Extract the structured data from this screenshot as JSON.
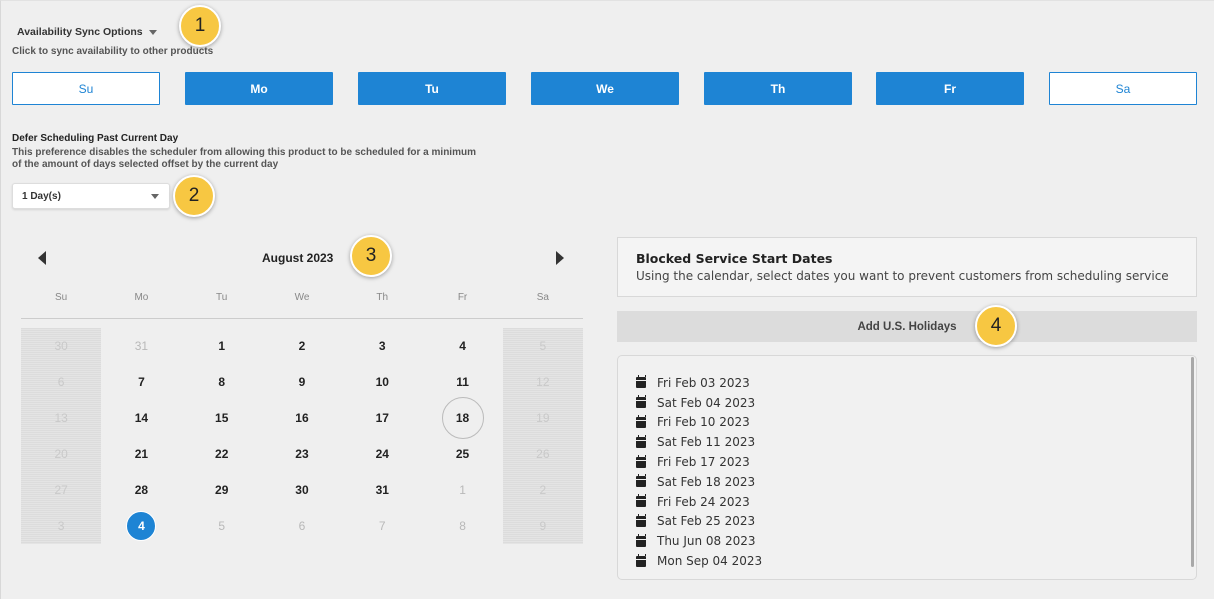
{
  "sync": {
    "title": "Availability Sync Options",
    "subtitle": "Click to sync availability to other products",
    "days": [
      {
        "label": "Su",
        "selected": false
      },
      {
        "label": "Mo",
        "selected": true
      },
      {
        "label": "Tu",
        "selected": true
      },
      {
        "label": "We",
        "selected": true
      },
      {
        "label": "Th",
        "selected": true
      },
      {
        "label": "Fr",
        "selected": true
      },
      {
        "label": "Sa",
        "selected": false
      }
    ]
  },
  "defer": {
    "title": "Defer Scheduling Past Current Day",
    "description": "This preference disables the scheduler from allowing this product to be scheduled for a minimum of the amount of days selected offset by the current day",
    "selected_value": "1 Day(s)"
  },
  "calendar": {
    "title": "August 2023",
    "weekdays": [
      "Su",
      "Mo",
      "Tu",
      "We",
      "Th",
      "Fr",
      "Sa"
    ],
    "weeks": [
      [
        "30",
        "31",
        "1",
        "2",
        "3",
        "4",
        "5"
      ],
      [
        "6",
        "7",
        "8",
        "9",
        "10",
        "11",
        "12"
      ],
      [
        "13",
        "14",
        "15",
        "16",
        "17",
        "18",
        "19"
      ],
      [
        "20",
        "21",
        "22",
        "23",
        "24",
        "25",
        "26"
      ],
      [
        "27",
        "28",
        "29",
        "30",
        "31",
        "1",
        "2"
      ],
      [
        "3",
        "4",
        "5",
        "6",
        "7",
        "8",
        "9"
      ]
    ],
    "today": "18",
    "selected": "4"
  },
  "blocked": {
    "title": "Blocked Service Start Dates",
    "description": "Using the calendar, select dates you want to prevent customers from scheduling service",
    "add_holidays_label": "Add U.S. Holidays",
    "dates": [
      "Fri Feb 03 2023",
      "Sat Feb 04 2023",
      "Fri Feb 10 2023",
      "Sat Feb 11 2023",
      "Fri Feb 17 2023",
      "Sat Feb 18 2023",
      "Fri Feb 24 2023",
      "Sat Feb 25 2023",
      "Thu Jun 08 2023",
      "Mon Sep 04 2023"
    ]
  },
  "callouts": [
    "1",
    "2",
    "3",
    "4"
  ],
  "colors": {
    "accent": "#1e84d4",
    "callout": "#f7c742",
    "background": "#efefef"
  }
}
